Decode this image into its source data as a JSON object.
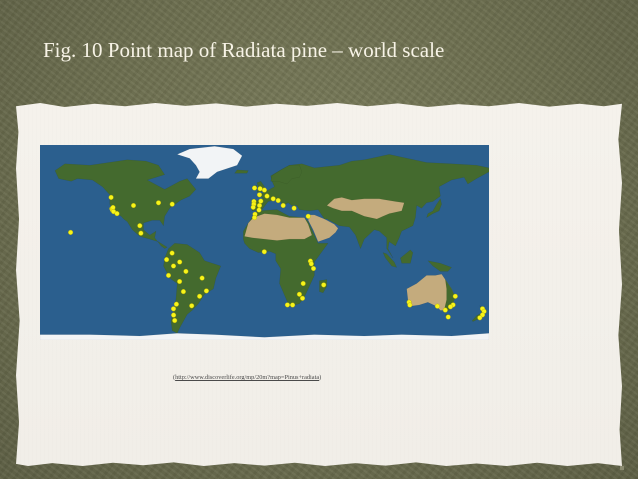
{
  "slide": {
    "title": "Fig. 10 Point map of Radiata pine – world scale",
    "caption_open": "(",
    "caption_link": "http://www.discoverlife.org/mp/20m?map=Pinus+radiata",
    "caption_close": ")"
  },
  "map": {
    "lon_range": [
      -180,
      180
    ],
    "lat_range": [
      -60,
      85
    ],
    "colors": {
      "ocean": "#2b5f8e",
      "land_vegetated": "#446a2e",
      "land_dry": "#c4ab7d",
      "ice": "#f2f4f6",
      "point": "#f7f51a"
    },
    "occurrences": [
      {
        "lat": 37.6,
        "lon": -122.4
      },
      {
        "lat": 36.6,
        "lon": -121.9
      },
      {
        "lat": 35.5,
        "lon": -121.0
      },
      {
        "lat": 34.0,
        "lon": -118.3
      },
      {
        "lat": 38.5,
        "lon": -121.5
      },
      {
        "lat": 46.0,
        "lon": -123.0
      },
      {
        "lat": 40.0,
        "lon": -105.0
      },
      {
        "lat": 19.4,
        "lon": -99.1
      },
      {
        "lat": 25.0,
        "lon": -100.0
      },
      {
        "lat": 42.0,
        "lon": -85.0
      },
      {
        "lat": 41.0,
        "lon": -74.0
      },
      {
        "lat": 20.0,
        "lon": -155.5
      },
      {
        "lat": 4.6,
        "lon": -74.1
      },
      {
        "lat": -0.2,
        "lon": -78.5
      },
      {
        "lat": -12.0,
        "lon": -77.0
      },
      {
        "lat": -5.0,
        "lon": -73.0
      },
      {
        "lat": -2.0,
        "lon": -68.0
      },
      {
        "lat": -9.0,
        "lon": -63.0
      },
      {
        "lat": -16.5,
        "lon": -68.1
      },
      {
        "lat": -14.0,
        "lon": -50.0
      },
      {
        "lat": -23.5,
        "lon": -46.6
      },
      {
        "lat": -27.5,
        "lon": -52.0
      },
      {
        "lat": -33.4,
        "lon": -70.6
      },
      {
        "lat": -36.8,
        "lon": -73.0
      },
      {
        "lat": -41.5,
        "lon": -72.9
      },
      {
        "lat": -45.5,
        "lon": -72.0
      },
      {
        "lat": -34.6,
        "lon": -58.4
      },
      {
        "lat": -24.0,
        "lon": -65.0
      },
      {
        "lat": 53.0,
        "lon": -8.0
      },
      {
        "lat": 51.5,
        "lon": -0.1
      },
      {
        "lat": 52.5,
        "lon": -3.5
      },
      {
        "lat": 48.0,
        "lon": -4.0
      },
      {
        "lat": 43.0,
        "lon": -8.5
      },
      {
        "lat": 43.3,
        "lon": -3.0
      },
      {
        "lat": 41.0,
        "lon": -8.6
      },
      {
        "lat": 38.7,
        "lon": -9.1
      },
      {
        "lat": 36.7,
        "lon": -4.4
      },
      {
        "lat": 45.0,
        "lon": 7.0
      },
      {
        "lat": 43.7,
        "lon": 11.0
      },
      {
        "lat": 40.0,
        "lon": 15.0
      },
      {
        "lat": 47.0,
        "lon": 2.0
      },
      {
        "lat": 38.0,
        "lon": 23.7
      },
      {
        "lat": 40.0,
        "lon": -4.0
      },
      {
        "lat": 32.0,
        "lon": 35.0
      },
      {
        "lat": 33.5,
        "lon": -7.6
      },
      {
        "lat": 31.0,
        "lon": -8.0
      },
      {
        "lat": 5.6,
        "lon": -0.2
      },
      {
        "lat": -1.3,
        "lon": 36.8
      },
      {
        "lat": -6.8,
        "lon": 39.3
      },
      {
        "lat": -3.4,
        "lon": 37.5
      },
      {
        "lat": -19.0,
        "lon": 47.5
      },
      {
        "lat": -18.0,
        "lon": 31.0
      },
      {
        "lat": -26.0,
        "lon": 28.0
      },
      {
        "lat": -29.0,
        "lon": 30.5
      },
      {
        "lat": -33.9,
        "lon": 18.4
      },
      {
        "lat": -34.0,
        "lon": 22.5
      },
      {
        "lat": -33.9,
        "lon": 151.2
      },
      {
        "lat": -37.8,
        "lon": 145.0
      },
      {
        "lat": -35.3,
        "lon": 149.1
      },
      {
        "lat": -31.9,
        "lon": 115.9
      },
      {
        "lat": -34.0,
        "lon": 116.5
      },
      {
        "lat": -27.5,
        "lon": 153.0
      },
      {
        "lat": -34.9,
        "lon": 138.6
      },
      {
        "lat": -42.9,
        "lon": 147.3
      },
      {
        "lat": -36.8,
        "lon": 174.8
      },
      {
        "lat": -38.7,
        "lon": 176.1
      },
      {
        "lat": -41.3,
        "lon": 174.8
      },
      {
        "lat": -43.5,
        "lon": 172.6
      }
    ]
  }
}
